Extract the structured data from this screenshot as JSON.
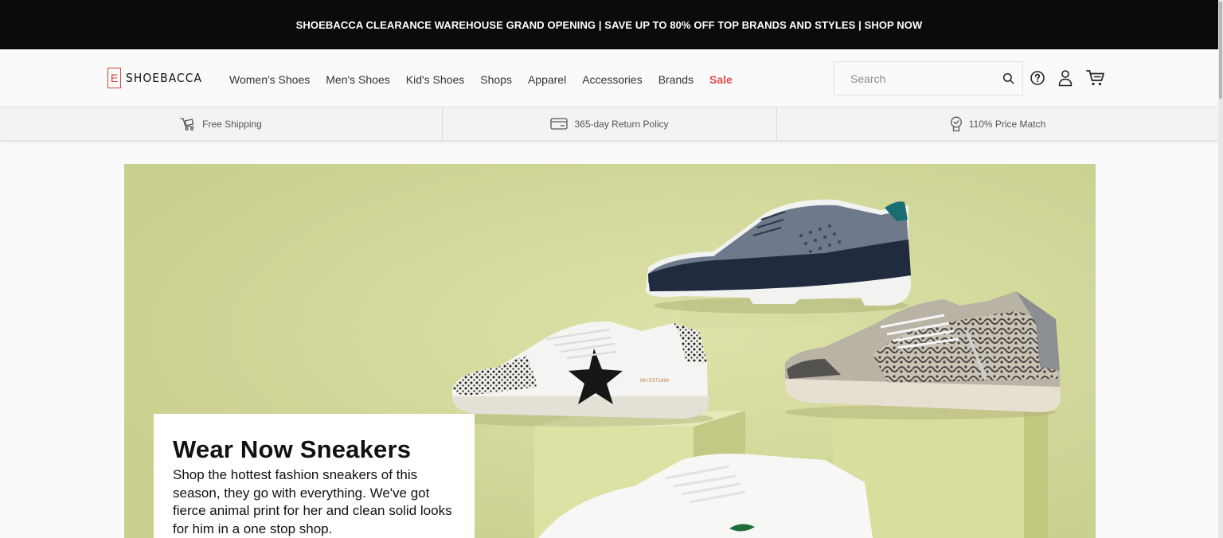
{
  "promo": {
    "text": "SHOEBACCA CLEARANCE WAREHOUSE GRAND OPENING | SAVE UP TO 80% OFF TOP BRANDS AND STYLES | SHOP NOW"
  },
  "header": {
    "logo_text": "SHOEBACCA",
    "logo_mark": "E",
    "nav": [
      {
        "label": "Women's Shoes"
      },
      {
        "label": "Men's Shoes"
      },
      {
        "label": "Kid's Shoes"
      },
      {
        "label": "Shops"
      },
      {
        "label": "Apparel"
      },
      {
        "label": "Accessories"
      },
      {
        "label": "Brands"
      },
      {
        "label": "Sale",
        "color": "#e24d4d"
      }
    ],
    "search": {
      "placeholder": "Search",
      "value": ""
    },
    "icons": [
      "search-icon",
      "help-icon",
      "account-icon",
      "cart-icon"
    ]
  },
  "usp": [
    {
      "icon": "shipping-cart-icon",
      "label": "Free Shipping"
    },
    {
      "icon": "card-icon",
      "label": "365-day Return Policy"
    },
    {
      "icon": "price-tag-icon",
      "label": "110% Price Match"
    }
  ],
  "hero": {
    "title": "Wear Now Sneakers",
    "body": "Shop the hottest fashion sneakers of this season, they go with everything. We've got fierce animal print for her and clean solid looks for him in a one stop shop.",
    "background_color": "#d3d89c"
  },
  "colors": {
    "promo_bg": "#0b0b0b",
    "brand_red": "#d8423b",
    "sale_red": "#e24d4d"
  }
}
